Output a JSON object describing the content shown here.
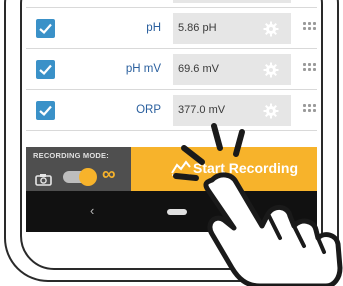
{
  "rows": [
    {
      "label": "pH",
      "value": "5.86 pH"
    },
    {
      "label": "pH mV",
      "value": "69.6 mV"
    },
    {
      "label": "ORP",
      "value": "377.0 mV"
    }
  ],
  "recording": {
    "mode_label": "RECORDING MODE:",
    "start_label": "Start Recording"
  },
  "colors": {
    "accent": "#f7b32b",
    "checkbox": "#3a91c8",
    "label_blue": "#2a5f9e"
  }
}
